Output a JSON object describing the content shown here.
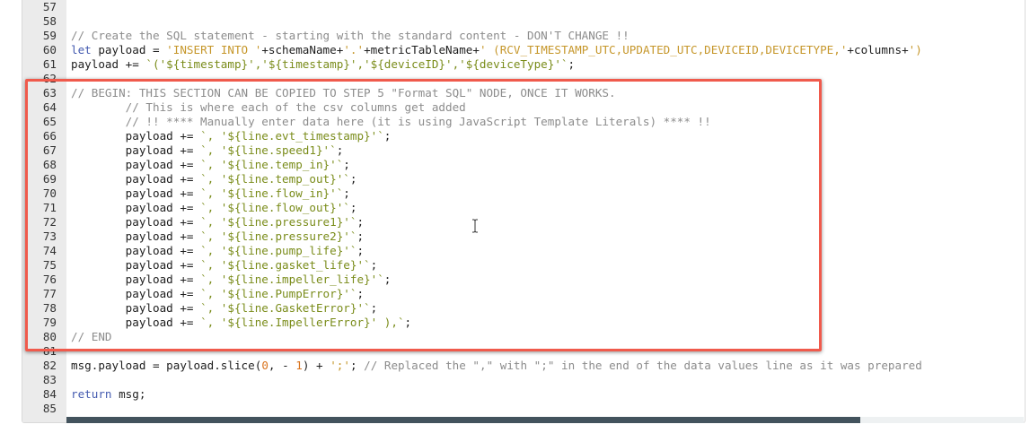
{
  "editor": {
    "lines": [
      {
        "num": "57",
        "tokens": []
      },
      {
        "num": "58",
        "tokens": []
      },
      {
        "num": "59",
        "tokens": [
          {
            "t": "comment",
            "v": "// Create the SQL statement - starting with the standard content - DON'T CHANGE !!"
          }
        ]
      },
      {
        "num": "60",
        "tokens": [
          {
            "t": "keyword",
            "v": "let"
          },
          {
            "t": "plain",
            "v": " payload = "
          },
          {
            "t": "string",
            "v": "'INSERT INTO '"
          },
          {
            "t": "plain",
            "v": "+schemaName+"
          },
          {
            "t": "string",
            "v": "'.'"
          },
          {
            "t": "plain",
            "v": "+metricTableName+"
          },
          {
            "t": "string",
            "v": "' (RCV_TIMESTAMP_UTC,UPDATED_UTC,DEVICEID,DEVICETYPE,'"
          },
          {
            "t": "plain",
            "v": "+columns+"
          },
          {
            "t": "string",
            "v": "')"
          }
        ]
      },
      {
        "num": "61",
        "tokens": [
          {
            "t": "plain",
            "v": "payload += "
          },
          {
            "t": "template",
            "v": "`('${timestamp}','${timestamp}','${deviceID}','${deviceType}'`"
          },
          {
            "t": "plain",
            "v": ";"
          }
        ]
      },
      {
        "num": "62",
        "tokens": []
      },
      {
        "num": "63",
        "tokens": [
          {
            "t": "comment",
            "v": "// BEGIN: THIS SECTION CAN BE COPIED TO STEP 5 \"Format SQL\" NODE, ONCE IT WORKS."
          }
        ]
      },
      {
        "num": "64",
        "tokens": [
          {
            "t": "comment",
            "v": "        // This is where each of the csv columns get added"
          }
        ]
      },
      {
        "num": "65",
        "tokens": [
          {
            "t": "comment",
            "v": "        // !! **** Manually enter data here (it is using JavaScript Template Literals) **** !!"
          }
        ]
      },
      {
        "num": "66",
        "tokens": [
          {
            "t": "plain",
            "v": "        payload += "
          },
          {
            "t": "template",
            "v": "`, '${line.evt_timestamp}'`"
          },
          {
            "t": "plain",
            "v": ";"
          }
        ]
      },
      {
        "num": "67",
        "tokens": [
          {
            "t": "plain",
            "v": "        payload += "
          },
          {
            "t": "template",
            "v": "`, '${line.speed1}'`"
          },
          {
            "t": "plain",
            "v": ";"
          }
        ]
      },
      {
        "num": "68",
        "tokens": [
          {
            "t": "plain",
            "v": "        payload += "
          },
          {
            "t": "template",
            "v": "`, '${line.temp_in}'`"
          },
          {
            "t": "plain",
            "v": ";"
          }
        ]
      },
      {
        "num": "69",
        "tokens": [
          {
            "t": "plain",
            "v": "        payload += "
          },
          {
            "t": "template",
            "v": "`, '${line.temp_out}'`"
          },
          {
            "t": "plain",
            "v": ";"
          }
        ]
      },
      {
        "num": "70",
        "tokens": [
          {
            "t": "plain",
            "v": "        payload += "
          },
          {
            "t": "template",
            "v": "`, '${line.flow_in}'`"
          },
          {
            "t": "plain",
            "v": ";"
          }
        ]
      },
      {
        "num": "71",
        "tokens": [
          {
            "t": "plain",
            "v": "        payload += "
          },
          {
            "t": "template",
            "v": "`, '${line.flow_out}'`"
          },
          {
            "t": "plain",
            "v": ";"
          }
        ]
      },
      {
        "num": "72",
        "tokens": [
          {
            "t": "plain",
            "v": "        payload += "
          },
          {
            "t": "template",
            "v": "`, '${line.pressure1}'`"
          },
          {
            "t": "plain",
            "v": ";"
          }
        ]
      },
      {
        "num": "73",
        "tokens": [
          {
            "t": "plain",
            "v": "        payload += "
          },
          {
            "t": "template",
            "v": "`, '${line.pressure2}'`"
          },
          {
            "t": "plain",
            "v": ";"
          }
        ]
      },
      {
        "num": "74",
        "tokens": [
          {
            "t": "plain",
            "v": "        payload += "
          },
          {
            "t": "template",
            "v": "`, '${line.pump_life}'`"
          },
          {
            "t": "plain",
            "v": ";"
          }
        ]
      },
      {
        "num": "75",
        "tokens": [
          {
            "t": "plain",
            "v": "        payload += "
          },
          {
            "t": "template",
            "v": "`, '${line.gasket_life}'`"
          },
          {
            "t": "plain",
            "v": ";"
          }
        ]
      },
      {
        "num": "76",
        "tokens": [
          {
            "t": "plain",
            "v": "        payload += "
          },
          {
            "t": "template",
            "v": "`, '${line.impeller_life}'`"
          },
          {
            "t": "plain",
            "v": ";"
          }
        ]
      },
      {
        "num": "77",
        "tokens": [
          {
            "t": "plain",
            "v": "        payload += "
          },
          {
            "t": "template",
            "v": "`, '${line.PumpError}'`"
          },
          {
            "t": "plain",
            "v": ";"
          }
        ]
      },
      {
        "num": "78",
        "tokens": [
          {
            "t": "plain",
            "v": "        payload += "
          },
          {
            "t": "template",
            "v": "`, '${line.GasketError}'`"
          },
          {
            "t": "plain",
            "v": ";"
          }
        ]
      },
      {
        "num": "79",
        "tokens": [
          {
            "t": "plain",
            "v": "        payload += "
          },
          {
            "t": "template",
            "v": "`, '${line.ImpellerError}' ),`"
          },
          {
            "t": "plain",
            "v": ";"
          }
        ]
      },
      {
        "num": "80",
        "tokens": [
          {
            "t": "comment",
            "v": "// END"
          }
        ]
      },
      {
        "num": "81",
        "tokens": []
      },
      {
        "num": "82",
        "tokens": [
          {
            "t": "plain",
            "v": "msg.payload = payload.slice("
          },
          {
            "t": "number",
            "v": "0"
          },
          {
            "t": "plain",
            "v": ", - "
          },
          {
            "t": "number",
            "v": "1"
          },
          {
            "t": "plain",
            "v": ") + "
          },
          {
            "t": "string",
            "v": "';'"
          },
          {
            "t": "plain",
            "v": "; "
          },
          {
            "t": "comment",
            "v": "// Replaced the \",\" with \";\" in the end of the data values line as it was prepared"
          }
        ]
      },
      {
        "num": "83",
        "tokens": []
      },
      {
        "num": "84",
        "tokens": [
          {
            "t": "keyword",
            "v": "return"
          },
          {
            "t": "plain",
            "v": " msg;"
          }
        ]
      },
      {
        "num": "85",
        "tokens": []
      }
    ],
    "scroll_position": 0.83
  },
  "colors": {
    "comment": "#8c8c8c",
    "keyword": "#445bb0",
    "string": "#c6972b",
    "template": "#7a8c1a",
    "number": "#d9731d",
    "highlight_border": "#f05a4c",
    "scrollbar_thumb": "#43535d"
  }
}
